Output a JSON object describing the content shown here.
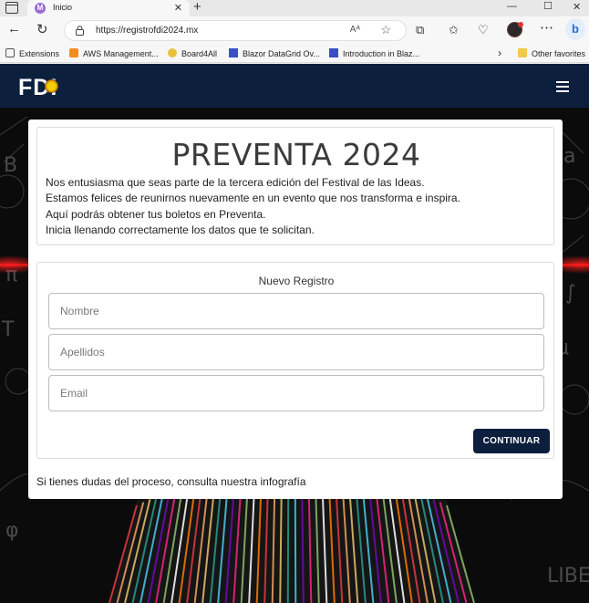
{
  "browser": {
    "tab_title": "Inicio",
    "url": "https://registrofdi2024.mx",
    "read_aloud": "Aᴬ",
    "bookmarks": [
      {
        "label": "Extensions",
        "icon": "puzzle-icon",
        "color": "#555555"
      },
      {
        "label": "AWS Management...",
        "icon": "aws-icon",
        "color": "#f28b1e"
      },
      {
        "label": "Board4All",
        "icon": "board4all-icon",
        "color": "#c9a020"
      },
      {
        "label": "Blazor DataGrid Ov...",
        "icon": "syncfusion-icon",
        "color": "#3b4fc4"
      },
      {
        "label": "Introduction in Blaz...",
        "icon": "syncfusion-icon",
        "color": "#3b4fc4"
      }
    ],
    "other_favorites": "Other favorites"
  },
  "site": {
    "logo_text": "FDI",
    "brand_color": "#0c1f3d"
  },
  "intro": {
    "title": "PREVENTA 2024",
    "lines": [
      "Nos entusiasma que seas parte de la tercera edición del Festival de las Ideas.",
      "Estamos felices de reunirnos nuevamente en un evento que nos transforma e inspira.",
      "Aquí podrás obtener tus boletos en Preventa.",
      "Inicia llenando correctamente los datos que te solicitan."
    ]
  },
  "form": {
    "title": "Nuevo Registro",
    "fields": [
      {
        "placeholder": "Nombre",
        "value": ""
      },
      {
        "placeholder": "Apellidos",
        "value": ""
      },
      {
        "placeholder": "Email",
        "value": ""
      }
    ],
    "submit_label": "CONTINUAR"
  },
  "footer_note": "Si tienes dudas del proceso, consulta nuestra infografía"
}
